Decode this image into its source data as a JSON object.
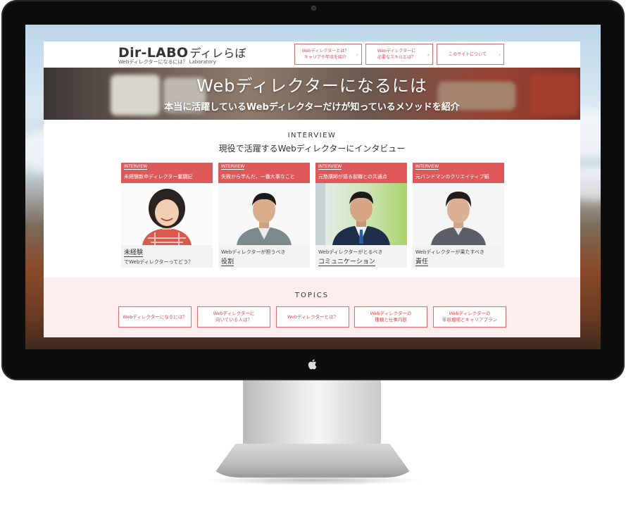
{
  "site": {
    "logo": "Dir-LABO",
    "logo_kana": "ディレらぼ",
    "tagline": "Webディレクターになるには？ Laboratory"
  },
  "nav": [
    {
      "line1": "Webディレクターとは？",
      "line2": "キャリアや年収を紹介"
    },
    {
      "line1": "Webディレクターに",
      "line2": "必要なスキルとは？"
    },
    {
      "line1": "このサイトについて",
      "line2": ""
    }
  ],
  "hero": {
    "title": "Webディレクターになるには",
    "subtitle": "本当に活躍しているWebディレクターだけが知っているメソッドを紹介"
  },
  "interview": {
    "heading": "INTERVIEW",
    "subheading": "現役で活躍するWebディレクターにインタビュー",
    "cards": [
      {
        "tag": "INTERVIEW",
        "title": "未経験新卒ディレクター奮闘記",
        "role": "未経験",
        "lead": "でWebディレクターってどう？"
      },
      {
        "tag": "INTERVIEW",
        "title": "失敗から学んだ、一番大事なこと",
        "lead": "Webディレクターが担うべき",
        "role": "役割"
      },
      {
        "tag": "INTERVIEW",
        "title": "元塾講師が語る前職との共通点",
        "lead": "Webディレクターがとるべき",
        "role": "コミュニケーション"
      },
      {
        "tag": "INTERVIEW",
        "title": "元バンドマンのクリエイティブ観",
        "lead": "Webディレクターが果たすべき",
        "role": "責任"
      }
    ]
  },
  "topics": {
    "heading": "TOPICS",
    "items": [
      {
        "line1": "Webディレクターになるには？",
        "line2": ""
      },
      {
        "line1": "Webディレクターに",
        "line2": "向いている人は？"
      },
      {
        "line1": "Webディレクターとは？",
        "line2": ""
      },
      {
        "line1": "Webディレクターの",
        "line2": "種類と仕事内容"
      },
      {
        "line1": "Webディレクターの",
        "line2": "年収相場とキャリアプラン"
      }
    ]
  },
  "colors": {
    "accent": "#e0595a",
    "topics_bg": "#fdeeee",
    "bezel": "#0d0d0d"
  },
  "icons": [
    "apple-logo-icon",
    "chevron-right-icon"
  ]
}
